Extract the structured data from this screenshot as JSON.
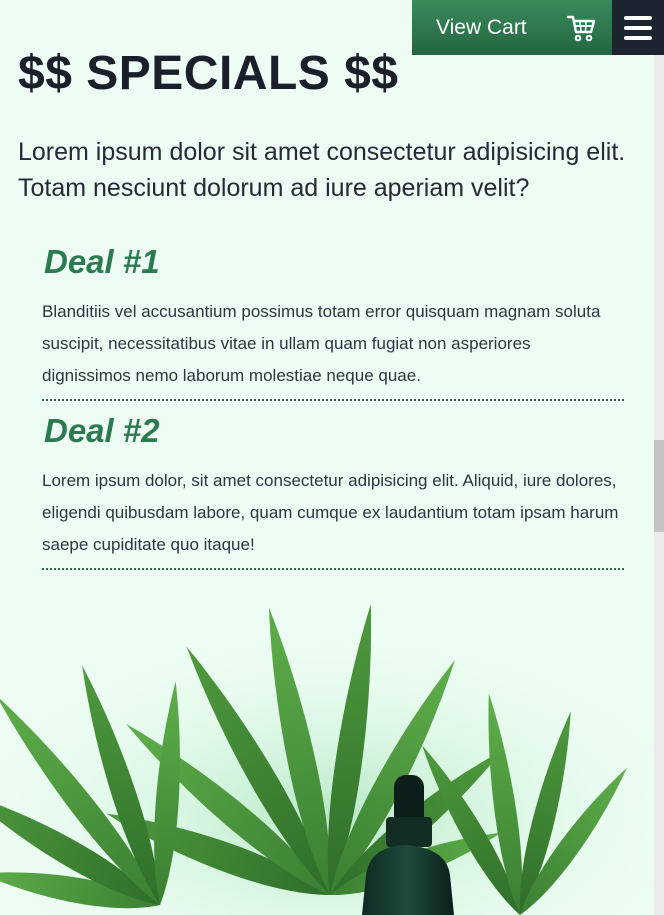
{
  "header": {
    "cart_label": "View Cart",
    "cart_icon": "shopping-cart-icon",
    "menu_icon": "hamburger-menu-icon"
  },
  "page": {
    "title": "$$ SPECIALS $$",
    "intro": "Lorem ipsum dolor sit amet consectetur adipisicing elit. Totam nesciunt dolorum ad iure aperiam velit?"
  },
  "deals": [
    {
      "title": "Deal #1",
      "text": "Blanditiis vel accusantium possimus totam error quisquam magnam soluta suscipit, necessitatibus vitae in ullam quam fugiat non asperiores dignissimos nemo laborum molestiae neque quae."
    },
    {
      "title": "Deal #2",
      "text": "Lorem ipsum dolor, sit amet consectetur adipisicing elit. Aliquid, iure dolores, eligendi quibusdam labore, quam cumque ex laudantium totam ipsam harum saepe cupiditate quo itaque!"
    }
  ],
  "colors": {
    "background": "#edfdf3",
    "accent_green": "#2c7a50",
    "cart_button": "#2f7a4e",
    "menu_button": "#1c2430"
  }
}
